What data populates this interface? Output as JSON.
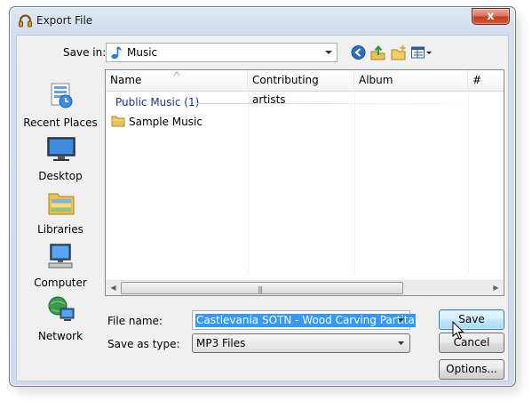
{
  "window": {
    "title": "Export File",
    "close_label": "x"
  },
  "toolbar": {
    "save_in_label": "Save in:",
    "save_in_value": "Music",
    "icons": [
      "back-icon",
      "up-folder-icon",
      "new-folder-icon",
      "view-menu-icon"
    ]
  },
  "places": [
    {
      "label": "Recent Places",
      "icon": "recent-places-icon"
    },
    {
      "label": "Desktop",
      "icon": "desktop-icon"
    },
    {
      "label": "Libraries",
      "icon": "libraries-icon"
    },
    {
      "label": "Computer",
      "icon": "computer-icon"
    },
    {
      "label": "Network",
      "icon": "network-icon"
    }
  ],
  "filelist": {
    "columns": [
      "Name",
      "Contributing artists",
      "Album",
      "#"
    ],
    "group": "Public Music (1)",
    "items": [
      {
        "name": "Sample Music",
        "icon": "folder-icon"
      }
    ]
  },
  "form": {
    "file_name_label": "File name:",
    "file_name_value": "Castlevania SOTN - Wood Carving Partita",
    "save_as_type_label": "Save as type:",
    "save_as_type_value": "MP3 Files"
  },
  "buttons": {
    "save": "Save",
    "cancel": "Cancel",
    "options": "Options..."
  },
  "colors": {
    "selection": "#3399ff",
    "group_text": "#1e3287",
    "close_button": "#c43b1f"
  }
}
